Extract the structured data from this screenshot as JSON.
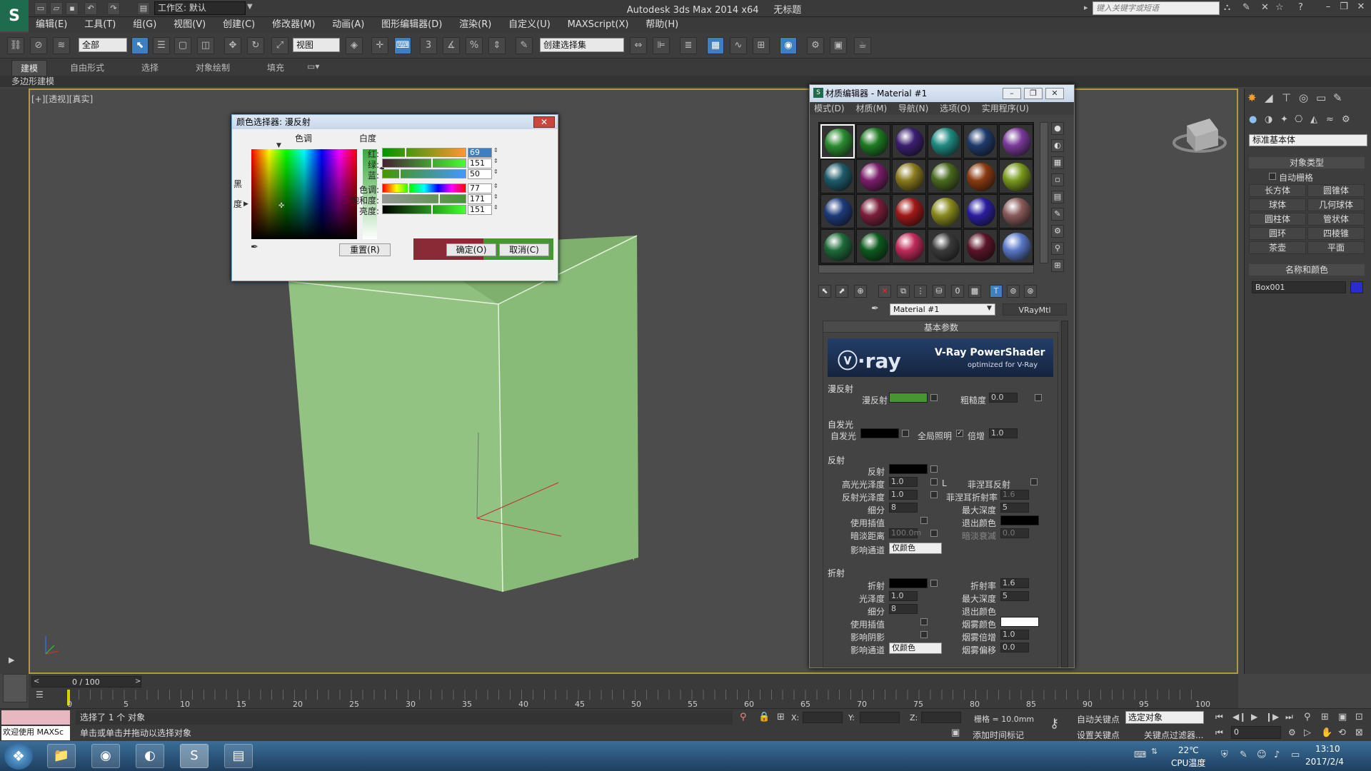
{
  "app": {
    "title": "Autodesk 3ds Max  2014 x64",
    "doc_title": "无标题",
    "workspace": "工作区: 默认",
    "search_placeholder": "键入关键字或短语"
  },
  "menu": [
    "编辑(E)",
    "工具(T)",
    "组(G)",
    "视图(V)",
    "创建(C)",
    "修改器(M)",
    "动画(A)",
    "图形编辑器(D)",
    "渲染(R)",
    "自定义(U)",
    "MAXScript(X)",
    "帮助(H)"
  ],
  "toolbar": {
    "filter": "全部",
    "ref_coord": "视图",
    "named_sel": "创建选择集"
  },
  "ribbon": {
    "tabs": [
      "建模",
      "自由形式",
      "选择",
      "对象绘制",
      "填充"
    ],
    "sub": "多边形建模"
  },
  "viewport": {
    "label": "[+][透视][真实]"
  },
  "color_picker": {
    "title": "颜色选择器: 漫反射",
    "hue_label": "色调",
    "whiteness_label": "白度",
    "black_label": "黑",
    "degree_label": "度",
    "rows": [
      {
        "label": "红:",
        "value": "69",
        "fill": 0.27
      },
      {
        "label": "绿:",
        "value": "151",
        "fill": 0.59
      },
      {
        "label": "蓝:",
        "value": "50",
        "fill": 0.2
      },
      {
        "label": "色调:",
        "value": "77",
        "fill": 0.3
      },
      {
        "label": "饱和度:",
        "value": "171",
        "fill": 0.67
      },
      {
        "label": "亮度:",
        "value": "151",
        "fill": 0.59
      }
    ],
    "old_color": "#8a2a36",
    "new_color": "#45972f",
    "reset": "重置(R)",
    "ok": "确定(O)",
    "cancel": "取消(C)"
  },
  "material_editor": {
    "title": "材质编辑器 - Material #1",
    "menu": [
      "模式(D)",
      "材质(M)",
      "导航(N)",
      "选项(O)",
      "实用程序(U)"
    ],
    "material_name": "Material #1",
    "material_type": "VRayMtl",
    "slot_colors": [
      "#2a8a30",
      "#1e7a22",
      "#3a1e70",
      "#1f8a82",
      "#1e3a6a",
      "#7a3a9a",
      "#1e5a6a",
      "#7a1e6a",
      "#8a7a1e",
      "#4a6a1e",
      "#8a3a10",
      "#7a9a1e",
      "#1e3a7a",
      "#7a1e3a",
      "#a01818",
      "#8a8a1e",
      "#2a1ea0",
      "#8a5a5a",
      "#1e6a3a",
      "#0e5a1e",
      "#c02a5a",
      "#3a3a3a",
      "#5a1428",
      "#5a78c8"
    ],
    "basic_params": "基本参数",
    "vray_title": "V-Ray PowerShader",
    "vray_sub": "optimized for V-Ray",
    "diffuse_group": "漫反射",
    "diffuse_label": "漫反射",
    "diffuse_color": "#45972f",
    "roughness_label": "粗糙度",
    "roughness_val": "0.0",
    "selfillum_group": "自发光",
    "selfillum_label": "自发光",
    "gi_label": "全局照明",
    "mult_label": "倍增",
    "mult_val": "1.0",
    "refl_group": "反射",
    "reflect_label": "反射",
    "hilight_gloss_label": "高光光泽度",
    "hilight_gloss_val": "1.0",
    "L_label": "L",
    "fresnel_label": "菲涅耳反射",
    "refl_gloss_label": "反射光泽度",
    "refl_gloss_val": "1.0",
    "fresnel_ior_label": "菲涅耳折射率",
    "fresnel_ior_val": "1.6",
    "subdivs_label": "细分",
    "subdivs_val": "8",
    "max_depth_label": "最大深度",
    "max_depth_val": "5",
    "use_interp_label": "使用插值",
    "exit_color_label": "退出颜色",
    "dim_dist_label": "暗淡距离",
    "dim_dist_val": "100.0m",
    "dim_falloff_label": "暗淡衰减",
    "dim_falloff_val": "0.0",
    "affect_ch_label": "影响通道",
    "affect_ch_val": "仅颜色",
    "refr_group": "折射",
    "refract_label": "折射",
    "ior_label": "折射率",
    "ior_val": "1.6",
    "gloss_label": "光泽度",
    "gloss_val": "1.0",
    "refr_max_depth_val": "5",
    "refr_subdivs_val": "8",
    "fog_color_label": "烟雾颜色",
    "use_interp2_label": "使用插值",
    "affect_shadows_label": "影响阴影",
    "fog_mult_label": "烟雾倍增",
    "fog_mult_val": "1.0",
    "affect_ch2_label": "影响通道",
    "affect_ch2_val": "仅颜色",
    "fog_bias_label": "烟雾偏移",
    "fog_bias_val": "0.0"
  },
  "command_panel": {
    "category": "标准基本体",
    "object_type": "对象类型",
    "autogrid": "自动栅格",
    "buttons": [
      "长方体",
      "圆锥体",
      "球体",
      "几何球体",
      "圆柱体",
      "管状体",
      "圆环",
      "四棱锥",
      "茶壶",
      "平面"
    ],
    "name_color": "名称和颜色",
    "object_name": "Box001"
  },
  "timeline": {
    "frame": "0 / 100",
    "ticks": [
      "0",
      "5",
      "10",
      "15",
      "20",
      "25",
      "30",
      "35",
      "40",
      "45",
      "50",
      "55",
      "60",
      "65",
      "70",
      "75",
      "80",
      "85",
      "90",
      "95",
      "100"
    ]
  },
  "status": {
    "maxscript": "欢迎使用 MAXSc",
    "selected": "选择了 1 个 对象",
    "prompt": "单击或单击并拖动以选择对象",
    "x_label": "X:",
    "y_label": "Y:",
    "z_label": "Z:",
    "grid": "栅格 = 10.0mm",
    "autokey": "自动关键点",
    "selected_obj": "选定对象",
    "setkey": "设置关键点",
    "keyfilter": "关键点过滤器...",
    "add_time_tag": "添加时间标记",
    "frame_val": "0"
  },
  "taskbar": {
    "temp": "22℃",
    "cpu": "CPU温度",
    "time": "13:10",
    "date": "2017/2/4"
  }
}
